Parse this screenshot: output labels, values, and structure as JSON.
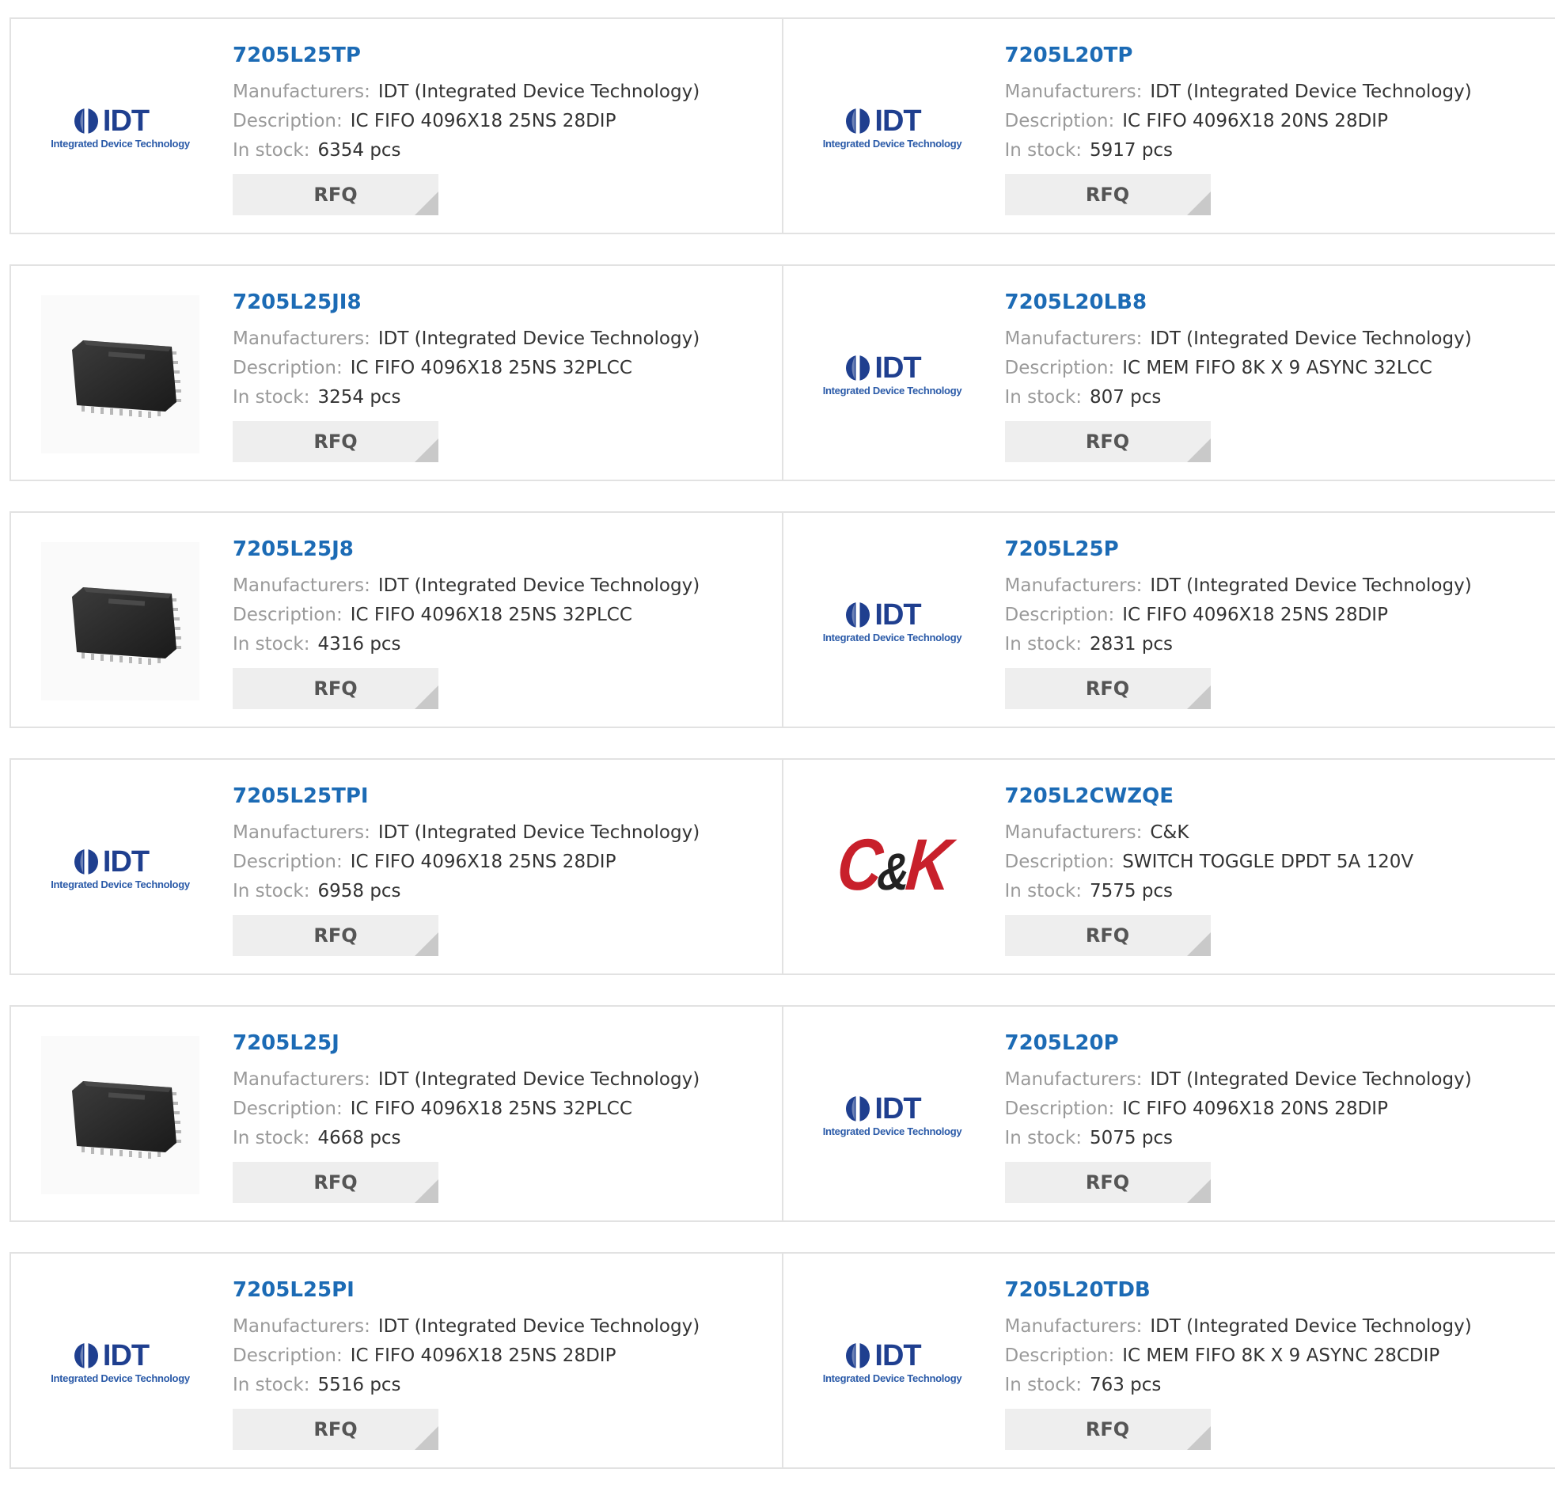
{
  "labels": {
    "manufacturer": "Manufacturers:",
    "description": "Description:",
    "stock": "In stock:",
    "rfq": "RFQ"
  },
  "logos": {
    "idt_word": "IDT",
    "idt_sub": "Integrated Device Technology",
    "ck_c": "C",
    "ck_amp": "&",
    "ck_k": "K"
  },
  "colors": {
    "part_link": "#1c6bb5",
    "idt_blue": "#1f3f8f",
    "ck_red": "#c8202b"
  },
  "products": [
    {
      "part": "7205L25TP",
      "manufacturer": "IDT (Integrated Device Technology)",
      "description": "IC FIFO 4096X18 25NS 28DIP",
      "stock": "6354 pcs",
      "image": "idt-logo"
    },
    {
      "part": "7205L20TP",
      "manufacturer": "IDT (Integrated Device Technology)",
      "description": "IC FIFO 4096X18 20NS 28DIP",
      "stock": "5917 pcs",
      "image": "idt-logo"
    },
    {
      "part": "7205L25JI8",
      "manufacturer": "IDT (Integrated Device Technology)",
      "description": "IC FIFO 4096X18 25NS 32PLCC",
      "stock": "3254 pcs",
      "image": "plcc-chip"
    },
    {
      "part": "7205L20LB8",
      "manufacturer": "IDT (Integrated Device Technology)",
      "description": "IC MEM FIFO 8K X 9 ASYNC 32LCC",
      "stock": "807 pcs",
      "image": "idt-logo"
    },
    {
      "part": "7205L25J8",
      "manufacturer": "IDT (Integrated Device Technology)",
      "description": "IC FIFO 4096X18 25NS 32PLCC",
      "stock": "4316 pcs",
      "image": "plcc-chip"
    },
    {
      "part": "7205L25P",
      "manufacturer": "IDT (Integrated Device Technology)",
      "description": "IC FIFO 4096X18 25NS 28DIP",
      "stock": "2831 pcs",
      "image": "idt-logo"
    },
    {
      "part": "7205L25TPI",
      "manufacturer": "IDT (Integrated Device Technology)",
      "description": "IC FIFO 4096X18 25NS 28DIP",
      "stock": "6958 pcs",
      "image": "idt-logo"
    },
    {
      "part": "7205L2CWZQE",
      "manufacturer": "C&K",
      "description": "SWITCH TOGGLE DPDT 5A 120V",
      "stock": "7575 pcs",
      "image": "ck-logo"
    },
    {
      "part": "7205L25J",
      "manufacturer": "IDT (Integrated Device Technology)",
      "description": "IC FIFO 4096X18 25NS 32PLCC",
      "stock": "4668 pcs",
      "image": "plcc-chip"
    },
    {
      "part": "7205L20P",
      "manufacturer": "IDT (Integrated Device Technology)",
      "description": "IC FIFO 4096X18 20NS 28DIP",
      "stock": "5075 pcs",
      "image": "idt-logo"
    },
    {
      "part": "7205L25PI",
      "manufacturer": "IDT (Integrated Device Technology)",
      "description": "IC FIFO 4096X18 25NS 28DIP",
      "stock": "5516 pcs",
      "image": "idt-logo"
    },
    {
      "part": "7205L20TDB",
      "manufacturer": "IDT (Integrated Device Technology)",
      "description": "IC MEM FIFO 8K X 9 ASYNC 28CDIP",
      "stock": "763 pcs",
      "image": "idt-logo"
    }
  ]
}
